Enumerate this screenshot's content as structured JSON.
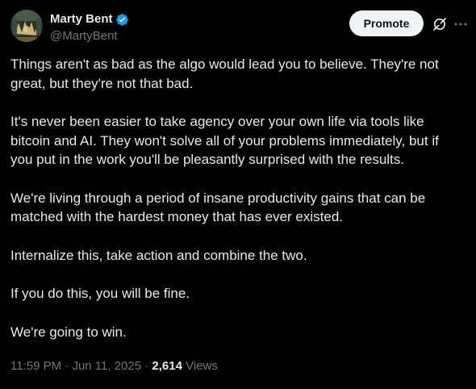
{
  "author": {
    "display_name": "Marty Bent",
    "handle": "@MartyBent",
    "verified": true,
    "verified_color": "#1d9bf0"
  },
  "actions": {
    "promote_label": "Promote",
    "grok_icon": "grok-icon",
    "more_icon": "more-icon"
  },
  "post": {
    "paragraphs": [
      "Things aren't as bad as the algo would lead you to believe. They're not great, but they're not that bad.",
      "It's never been easier to take agency over your own life via tools like bitcoin and AI. They won't solve all of your problems immediately, but if you put in the work you'll be pleasantly surprised with the results.",
      "We're living through a period of insane productivity gains that can be matched with the hardest money that has ever existed.",
      "Internalize this, take action and combine the two.",
      "If you do this, you will be fine.",
      "We're going to win."
    ]
  },
  "meta": {
    "time": "11:59 PM",
    "separator": " · ",
    "date": "Jun 11, 2025",
    "views_count": "2,614",
    "views_label": " Views"
  },
  "colors": {
    "background": "#000000",
    "text": "#e7e9ea",
    "secondary": "#71767b",
    "button_bg": "#eff3f4",
    "button_text": "#0f1419"
  }
}
